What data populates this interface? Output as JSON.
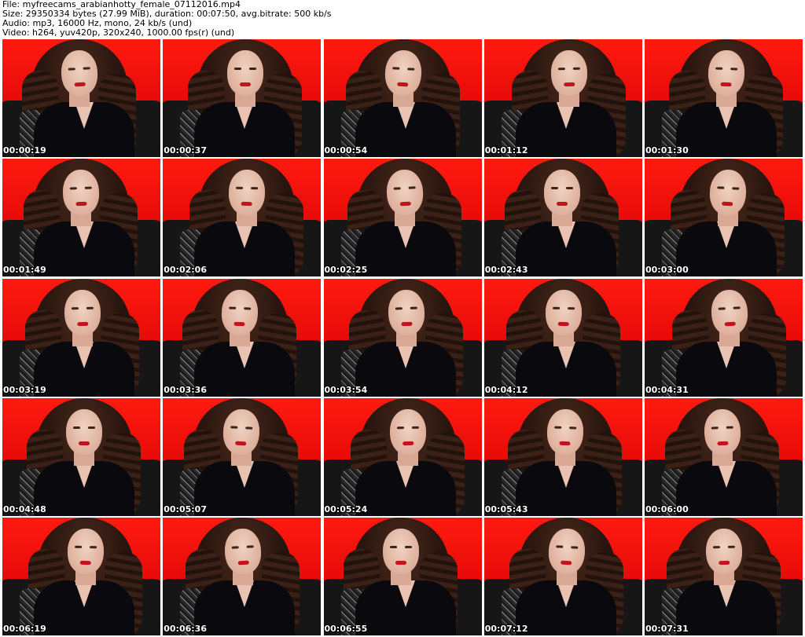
{
  "header": {
    "file": "File: myfreecams_arabianhotty_female_07112016.mp4",
    "size": "Size: 29350334 bytes (27.99 MiB), duration: 00:07:50, avg.bitrate: 500 kb/s",
    "audio": "Audio: mp3, 16000 Hz, mono, 24 kb/s (und)",
    "video": "Video: h264, yuv420p, 320x240, 1000.00 fps(r) (und)"
  },
  "thumbnails": [
    {
      "timestamp": "00:00:19"
    },
    {
      "timestamp": "00:00:37"
    },
    {
      "timestamp": "00:00:54"
    },
    {
      "timestamp": "00:01:12"
    },
    {
      "timestamp": "00:01:30"
    },
    {
      "timestamp": "00:01:49"
    },
    {
      "timestamp": "00:02:06"
    },
    {
      "timestamp": "00:02:25"
    },
    {
      "timestamp": "00:02:43"
    },
    {
      "timestamp": "00:03:00"
    },
    {
      "timestamp": "00:03:19"
    },
    {
      "timestamp": "00:03:36"
    },
    {
      "timestamp": "00:03:54"
    },
    {
      "timestamp": "00:04:12"
    },
    {
      "timestamp": "00:04:31"
    },
    {
      "timestamp": "00:04:48"
    },
    {
      "timestamp": "00:05:07"
    },
    {
      "timestamp": "00:05:24"
    },
    {
      "timestamp": "00:05:43"
    },
    {
      "timestamp": "00:06:00"
    },
    {
      "timestamp": "00:06:19"
    },
    {
      "timestamp": "00:06:36"
    },
    {
      "timestamp": "00:06:55"
    },
    {
      "timestamp": "00:07:12"
    },
    {
      "timestamp": "00:07:31"
    }
  ]
}
